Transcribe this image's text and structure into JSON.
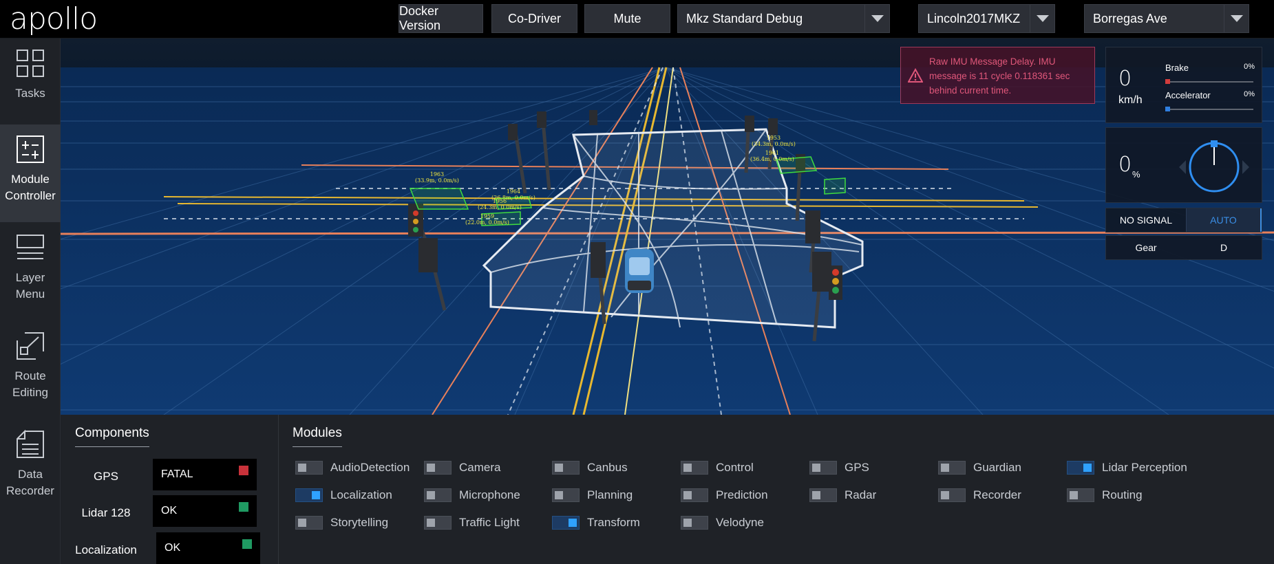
{
  "header": {
    "logo_text": "apollo",
    "buttons": {
      "docker_version": "Docker Version",
      "co_driver": "Co-Driver",
      "mute": "Mute"
    },
    "selects": {
      "mode": "Mkz Standard Debug",
      "vehicle": "Lincoln2017MKZ",
      "map": "Borregas Ave"
    }
  },
  "sidenav": {
    "items": [
      {
        "label": "Tasks",
        "icon": "grid-icon"
      },
      {
        "label": "Module Controller",
        "icon": "sliders-icon"
      },
      {
        "label": "Layer Menu",
        "icon": "layers-icon"
      },
      {
        "label": "Route Editing",
        "icon": "route-icon"
      },
      {
        "label": "Data Recorder",
        "icon": "document-icon"
      }
    ],
    "active": "Module Controller"
  },
  "alert": {
    "text": "Raw IMU Message Delay. IMU message is 11 cycle 0.118361 sec behind current time.",
    "color": "#e0577a"
  },
  "dashboard": {
    "speed": "0",
    "speed_unit": "km/h",
    "brake_label": "Brake",
    "brake_pct": "0%",
    "brake_value": 0,
    "accelerator_label": "Accelerator",
    "accelerator_pct": "0%",
    "accelerator_value": 0,
    "steering_pct": "0",
    "steering_pct_symbol": "%",
    "signal": "NO SIGNAL",
    "driving_mode": "AUTO",
    "gear_label": "Gear",
    "gear_value": "D",
    "brake_color": "#d23c3c",
    "accelerator_color": "#2f7fe0"
  },
  "scene_labels": [
    {
      "id": "1963",
      "text": "(33.9m, 0.0m/s)"
    },
    {
      "id": "1964",
      "text": "(26.8m, 0.0m/s)"
    },
    {
      "id": "1956",
      "text": "(24.3m, 0.0m/s)"
    },
    {
      "id": "1959",
      "text": "(22.0m, 0.0m/s)"
    },
    {
      "id": "1953",
      "text": "(34.3m, 0.0m/s)"
    },
    {
      "id": "1961",
      "text": "(36.4m, 0.0m/s)"
    }
  ],
  "components": {
    "title": "Components",
    "rows": [
      {
        "name": "GPS",
        "status": "FATAL",
        "color": "#c8323a"
      },
      {
        "name": "Lidar 128",
        "status": "OK",
        "color": "#1f9a62"
      },
      {
        "name": "Localization",
        "status": "OK",
        "color": "#1f9a62"
      }
    ]
  },
  "modules": {
    "title": "Modules",
    "items": [
      {
        "label": "AudioDetection",
        "on": false
      },
      {
        "label": "Camera",
        "on": false
      },
      {
        "label": "Canbus",
        "on": false
      },
      {
        "label": "Control",
        "on": false
      },
      {
        "label": "GPS",
        "on": false
      },
      {
        "label": "Guardian",
        "on": false
      },
      {
        "label": "Lidar Perception",
        "on": true
      },
      {
        "label": "Localization",
        "on": true
      },
      {
        "label": "Microphone",
        "on": false
      },
      {
        "label": "Planning",
        "on": false
      },
      {
        "label": "Prediction",
        "on": false
      },
      {
        "label": "Radar",
        "on": false
      },
      {
        "label": "Recorder",
        "on": false
      },
      {
        "label": "Routing",
        "on": false
      },
      {
        "label": "Storytelling",
        "on": false
      },
      {
        "label": "Traffic Light",
        "on": false
      },
      {
        "label": "Transform",
        "on": true
      },
      {
        "label": "Velodyne",
        "on": false
      }
    ]
  }
}
